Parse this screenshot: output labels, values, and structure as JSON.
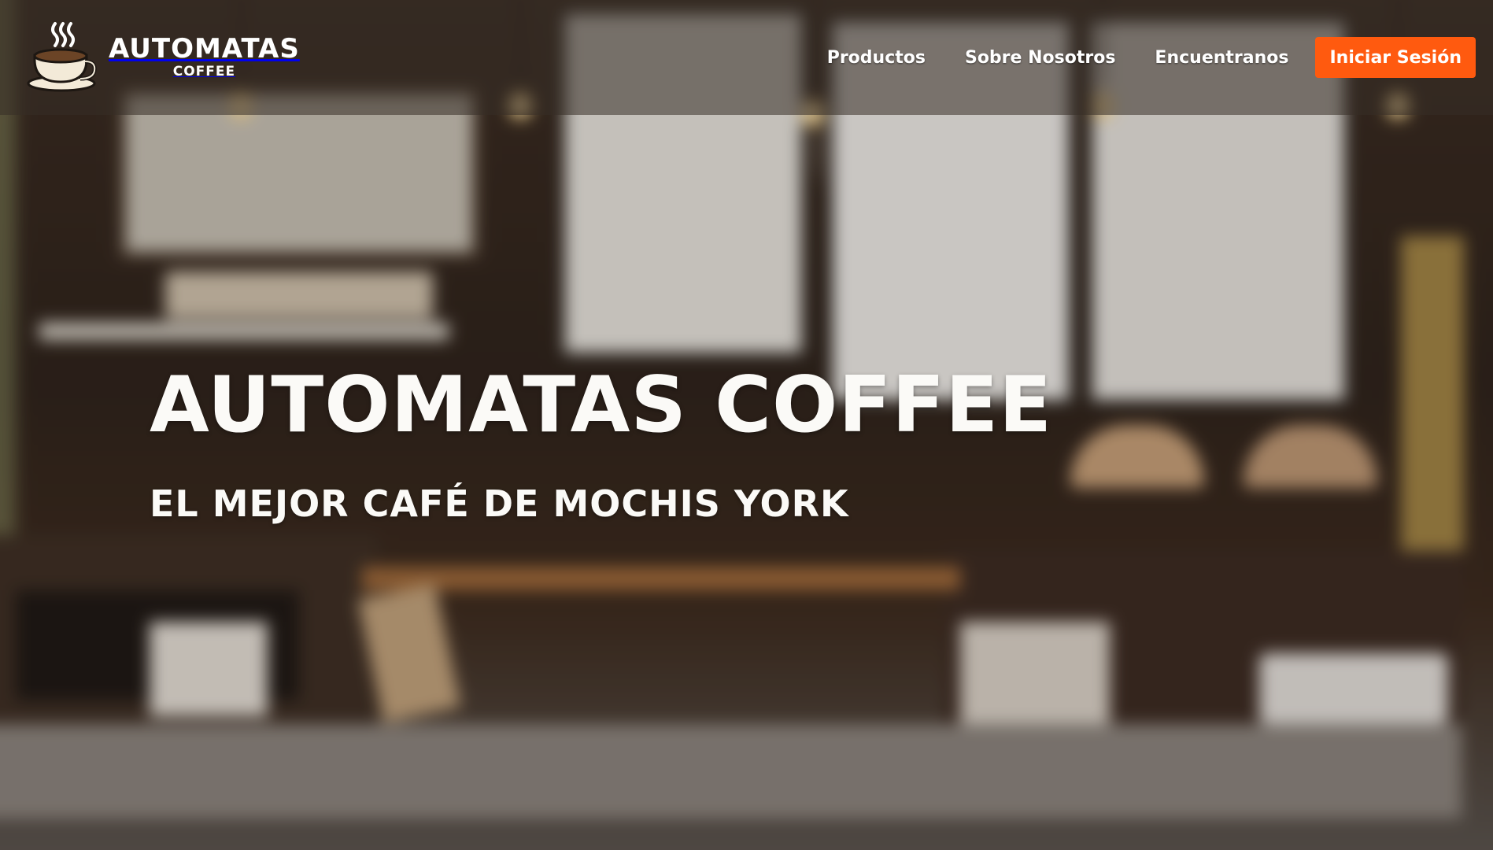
{
  "header": {
    "logo": {
      "title": "AUTOMATAS",
      "subtitle": "COFFEE",
      "icon": "coffee-cup-icon"
    },
    "nav": [
      {
        "label": "Productos"
      },
      {
        "label": "Sobre Nosotros"
      },
      {
        "label": "Encuentranos"
      }
    ],
    "login_label": "Iniciar Sesión"
  },
  "hero": {
    "title": "AUTOMATAS COFFEE",
    "subtitle": "EL MEJOR CAFÉ DE MOCHIS YORK"
  },
  "colors": {
    "accent": "#ff5a0f",
    "header_overlay": "rgba(55,45,38,0.55)",
    "text": "#ffffff"
  }
}
